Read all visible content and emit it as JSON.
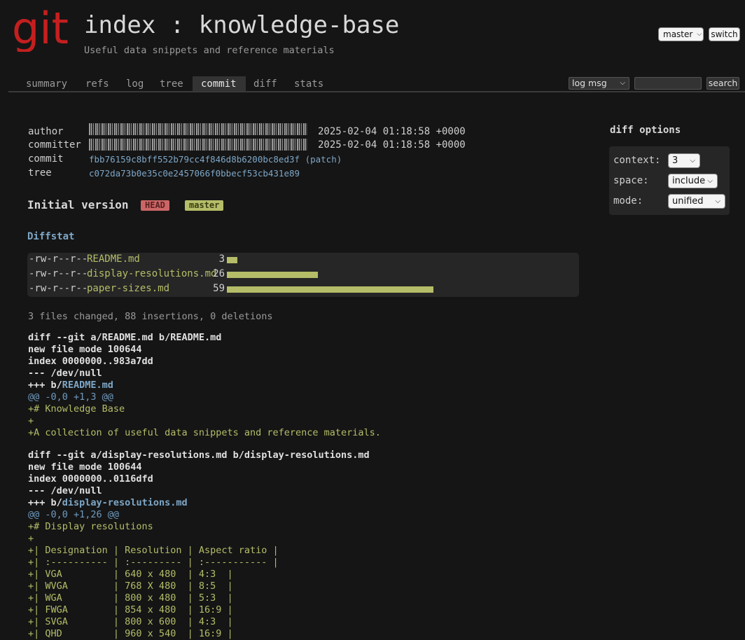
{
  "header": {
    "logo_text": "git",
    "title": "index : knowledge-base",
    "description": "Useful data snippets and reference materials",
    "branch_select": "master",
    "switch_label": "switch"
  },
  "tabs": [
    {
      "label": "summary"
    },
    {
      "label": "refs"
    },
    {
      "label": "log"
    },
    {
      "label": "tree"
    },
    {
      "label": "commit",
      "active": true
    },
    {
      "label": "diff"
    },
    {
      "label": "stats"
    }
  ],
  "search": {
    "scope": "log msg",
    "button_label": "search"
  },
  "commit_info": {
    "author_label": "author",
    "committer_label": "committer",
    "commit_label": "commit",
    "tree_label": "tree",
    "author_date": "2025-02-04 01:18:58 +0000",
    "committer_date": "2025-02-04 01:18:58 +0000",
    "commit_hash": "fbb76159c8bff552b79cc4f846d8b6200bc8ed3f",
    "patch_link": "(patch)",
    "tree_hash": "c072da73b0e35c0e2457066f0bbecf53cb431e89"
  },
  "commit_subject": "Initial version",
  "refs": {
    "head": "HEAD",
    "master": "master"
  },
  "diffstat": {
    "heading": "Diffstat",
    "files": [
      {
        "mode": "-rw-r--r--",
        "name": "README.md",
        "count": "3",
        "insertions": 3
      },
      {
        "mode": "-rw-r--r--",
        "name": "display-resolutions.md",
        "count": "26",
        "insertions": 26
      },
      {
        "mode": "-rw-r--r--",
        "name": "paper-sizes.md",
        "count": "59",
        "insertions": 59
      }
    ],
    "summary": "3 files changed, 88 insertions, 0 deletions"
  },
  "diff_lines": [
    {
      "type": "head",
      "text": "diff --git a/README.md b/README.md"
    },
    {
      "type": "head",
      "text": "new file mode 100644"
    },
    {
      "type": "head",
      "text": "index 0000000..983a7dd"
    },
    {
      "type": "head",
      "text": "--- /dev/null"
    },
    {
      "type": "headfile",
      "prefix": "+++ b/",
      "file": "README.md"
    },
    {
      "type": "hunk",
      "text": "@@ -0,0 +1,3 @@"
    },
    {
      "type": "add",
      "text": "+# Knowledge Base"
    },
    {
      "type": "add",
      "text": "+"
    },
    {
      "type": "add",
      "text": "+A collection of useful data snippets and reference materials."
    },
    {
      "type": "spacer",
      "text": ""
    },
    {
      "type": "head",
      "text": "diff --git a/display-resolutions.md b/display-resolutions.md"
    },
    {
      "type": "head",
      "text": "new file mode 100644"
    },
    {
      "type": "head",
      "text": "index 0000000..0116dfd"
    },
    {
      "type": "head",
      "text": "--- /dev/null"
    },
    {
      "type": "headfile",
      "prefix": "+++ b/",
      "file": "display-resolutions.md"
    },
    {
      "type": "hunk",
      "text": "@@ -0,0 +1,26 @@"
    },
    {
      "type": "add",
      "text": "+# Display resolutions"
    },
    {
      "type": "add",
      "text": "+"
    },
    {
      "type": "add",
      "text": "+| Designation | Resolution | Aspect ratio |"
    },
    {
      "type": "add",
      "text": "+| :---------- | :--------- | :----------- |"
    },
    {
      "type": "add",
      "text": "+| VGA         | 640 x 480  | 4:3  |"
    },
    {
      "type": "add",
      "text": "+| WVGA        | 768 X 480  | 8:5  |"
    },
    {
      "type": "add",
      "text": "+| WGA         | 800 x 480  | 5:3  |"
    },
    {
      "type": "add",
      "text": "+| FWGA        | 854 x 480  | 16:9 |"
    },
    {
      "type": "add",
      "text": "+| SVGA        | 800 x 600  | 4:3  |"
    },
    {
      "type": "add",
      "text": "+| QHD         | 960 x 540  | 16:9 |"
    }
  ],
  "diff_options": {
    "title": "diff options",
    "context_label": "context:",
    "context_value": "3",
    "space_label": "space:",
    "space_value": "include",
    "mode_label": "mode:",
    "mode_value": "unified"
  },
  "colors": {
    "logo": "#c41f1f",
    "link": "#7ea7c7",
    "added": "#b5bd68",
    "head_badge": "#cc6666",
    "background": "#151515"
  }
}
